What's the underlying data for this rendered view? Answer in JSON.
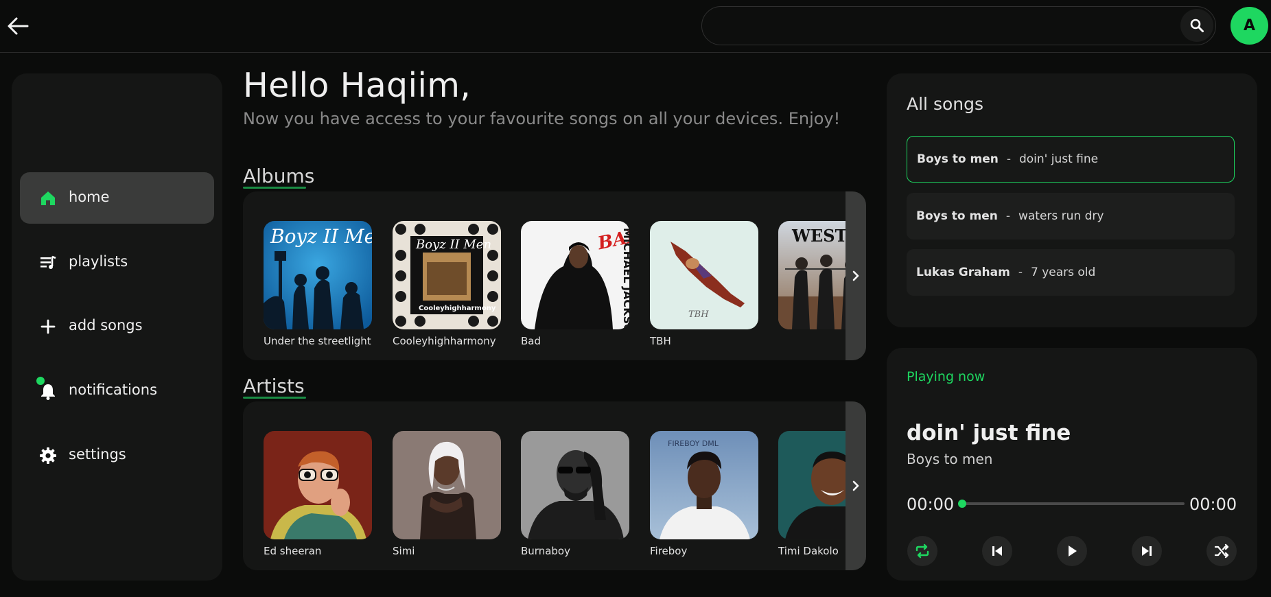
{
  "topbar": {
    "search_placeholder": "",
    "search_value": "",
    "avatar_initial": "A"
  },
  "sidebar": {
    "items": [
      {
        "label": "home",
        "icon": "home-icon",
        "active": true
      },
      {
        "label": "playlists",
        "icon": "playlist-icon"
      },
      {
        "label": "add songs",
        "icon": "plus-icon"
      },
      {
        "label": "notifications",
        "icon": "bell-icon",
        "has_dot": true
      },
      {
        "label": "settings",
        "icon": "gear-icon"
      }
    ]
  },
  "main": {
    "greeting": "Hello Haqiim,",
    "subtitle": "Now you have access to your favourite songs on all your devices. Enjoy!",
    "albums_title": "Albums",
    "albums": [
      {
        "name": "Under the streetlight"
      },
      {
        "name": "Cooleyhighharmony"
      },
      {
        "name": "Bad"
      },
      {
        "name": "TBH"
      },
      {
        "name": ""
      }
    ],
    "artists_title": "Artists",
    "artists": [
      {
        "name": "Ed sheeran"
      },
      {
        "name": "Simi"
      },
      {
        "name": "Burnaboy"
      },
      {
        "name": "Fireboy"
      },
      {
        "name": "Timi Dakolo"
      }
    ]
  },
  "all_songs": {
    "title": "All songs",
    "songs": [
      {
        "artist": "Boys to men",
        "separator": "-",
        "title": "doin' just fine",
        "active": true
      },
      {
        "artist": "Boys to men",
        "separator": "-",
        "title": "waters run dry"
      },
      {
        "artist": "Lukas Graham",
        "separator": "-",
        "title": "7 years old"
      }
    ]
  },
  "player": {
    "label": "Playing now",
    "title": "doin' just fine",
    "artist": "Boys to men",
    "current_time": "00:00",
    "total_time": "00:00",
    "progress": 0
  },
  "colors": {
    "accent": "#1ed760",
    "background": "#0b0c0b",
    "panel": "#151615"
  }
}
